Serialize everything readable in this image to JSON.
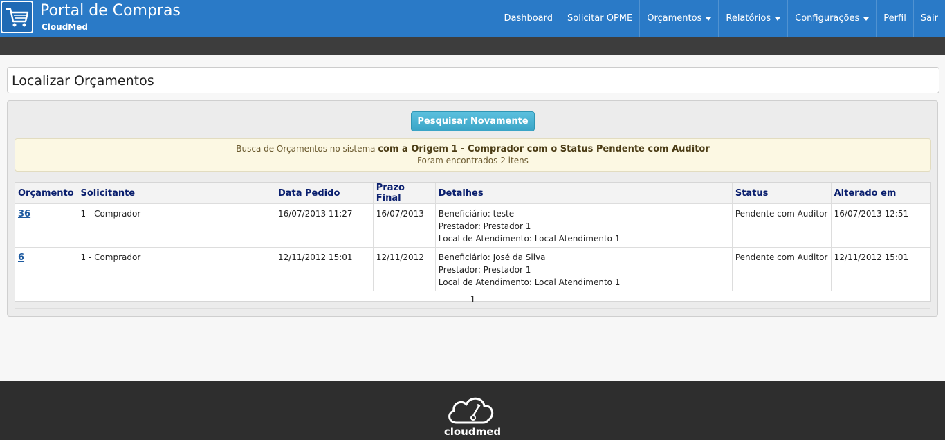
{
  "brand": {
    "title": "Portal de Compras",
    "subtitle": "CloudMed",
    "icon": "shopping-cart-icon"
  },
  "nav": {
    "items": [
      {
        "label": "Dashboard",
        "dropdown": false
      },
      {
        "label": "Solicitar OPME",
        "dropdown": false
      },
      {
        "label": "Orçamentos",
        "dropdown": true
      },
      {
        "label": "Relatórios",
        "dropdown": true
      },
      {
        "label": "Configurações",
        "dropdown": true
      },
      {
        "label": "Perfil",
        "dropdown": false
      },
      {
        "label": "Sair",
        "dropdown": false
      }
    ]
  },
  "page": {
    "title": "Localizar Orçamentos"
  },
  "search": {
    "button_label": "Pesquisar Novamente"
  },
  "alert": {
    "prefix": "Busca de Orçamentos no sistema ",
    "criteria": "com a Origem 1 - Comprador com o Status Pendente com Auditor",
    "result": "Foram encontrados 2 itens"
  },
  "table": {
    "headers": [
      "Orçamento",
      "Solicitante",
      "Data Pedido",
      "Prazo Final",
      "Detalhes",
      "Status",
      "Alterado em"
    ],
    "rows": [
      {
        "orcamento": "36",
        "solicitante": "1 - Comprador",
        "data_pedido": "16/07/2013 11:27",
        "prazo_final": "16/07/2013",
        "detalhes": [
          "Beneficiário: teste",
          "Prestador: Prestador 1",
          "Local de Atendimento: Local Atendimento 1"
        ],
        "status": "Pendente com Auditor",
        "alterado_em": "16/07/2013 12:51"
      },
      {
        "orcamento": "6",
        "solicitante": "1 - Comprador",
        "data_pedido": "12/11/2012 15:01",
        "prazo_final": "12/11/2012",
        "detalhes": [
          "Beneficiário: José da Silva",
          "Prestador: Prestador 1",
          "Local de Atendimento: Local Atendimento 1"
        ],
        "status": "Pendente com Auditor",
        "alterado_em": "12/11/2012 15:01"
      }
    ],
    "pager": "1"
  },
  "footer": {
    "logo_text": "cloudmed",
    "icon": "cloud-stethoscope-icon"
  },
  "colors": {
    "header": "#2a7ac7",
    "dark_bar": "#3d3d3d",
    "button": "#49afcd",
    "alert_bg": "#fcf8e3",
    "table_header_text": "#0a1f6e",
    "link": "#1d5aa0",
    "footer": "#2e2e2e"
  }
}
